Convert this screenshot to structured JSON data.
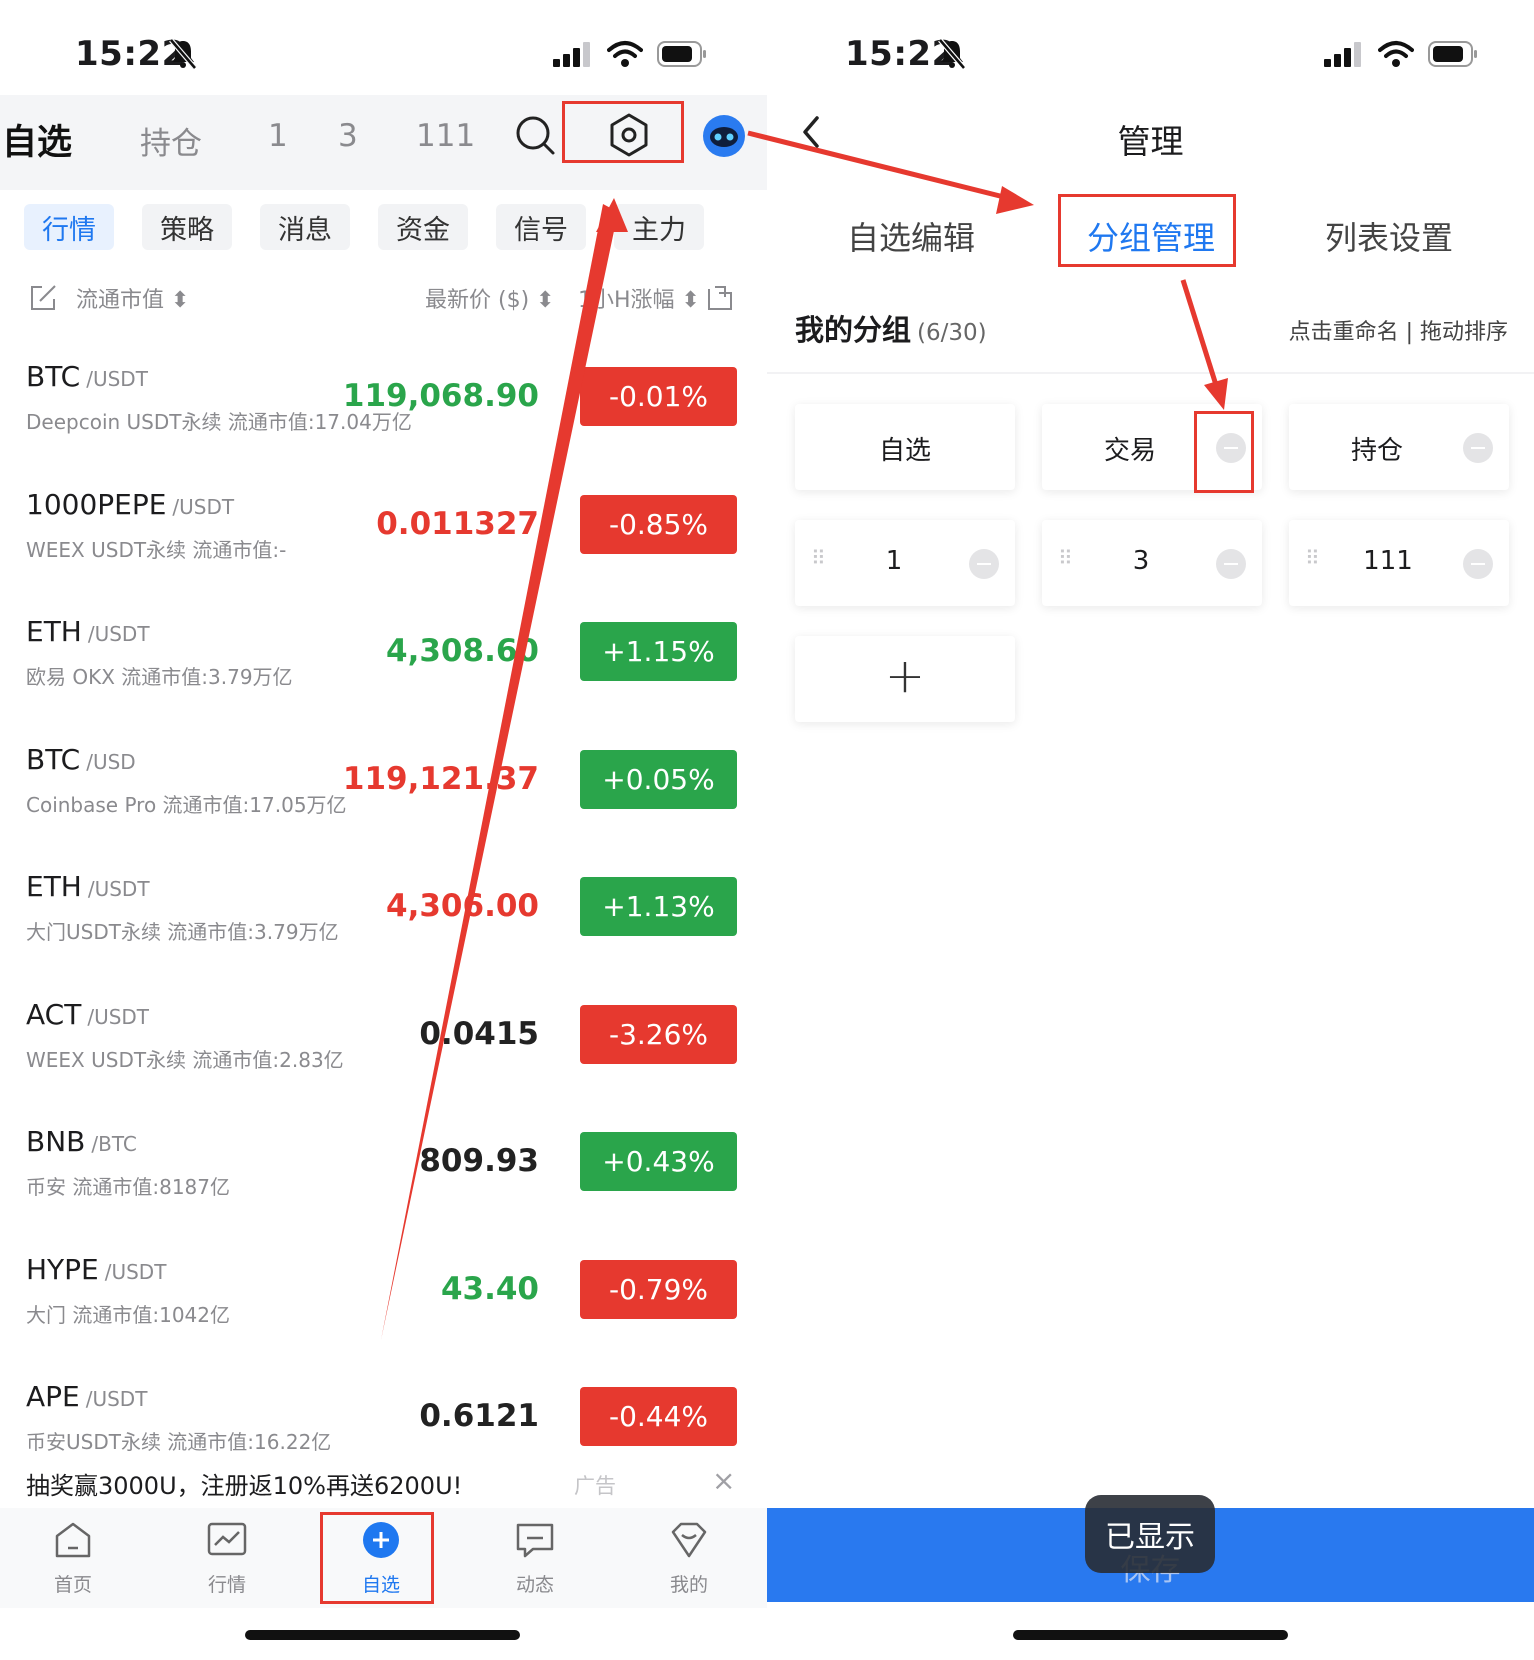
{
  "status": {
    "time": "15:22"
  },
  "left": {
    "group_tabs": [
      "自选",
      "持仓",
      "1",
      "3",
      "111"
    ],
    "sub_tabs": [
      "行情",
      "策略",
      "消息",
      "资金",
      "信号",
      "主力"
    ],
    "columns": {
      "market_cap": "流通市值",
      "latest_price": "最新价 ($)",
      "change_24h": "1小H涨幅"
    },
    "rows": [
      {
        "base": "BTC",
        "quote": "/USDT",
        "sub": "Deepcoin USDT永续  流通市值:17.04万亿",
        "price": "119,068.90",
        "change": "-0.01%",
        "price_dir": "up",
        "chg_dir": "down"
      },
      {
        "base": "1000PEPE",
        "quote": "/USDT",
        "sub": "WEEX USDT永续  流通市值:-",
        "price": "0.011327",
        "change": "-0.85%",
        "price_dir": "down",
        "chg_dir": "down"
      },
      {
        "base": "ETH",
        "quote": "/USDT",
        "sub": "欧易 OKX  流通市值:3.79万亿",
        "price": "4,308.60",
        "change": "+1.15%",
        "price_dir": "up",
        "chg_dir": "up"
      },
      {
        "base": "BTC",
        "quote": "/USD",
        "sub": "Coinbase Pro  流通市值:17.05万亿",
        "price": "119,121.37",
        "change": "+0.05%",
        "price_dir": "down",
        "chg_dir": "up"
      },
      {
        "base": "ETH",
        "quote": "/USDT",
        "sub": "大门USDT永续  流通市值:3.79万亿",
        "price": "4,306.00",
        "change": "+1.13%",
        "price_dir": "down",
        "chg_dir": "up"
      },
      {
        "base": "ACT",
        "quote": "/USDT",
        "sub": "WEEX USDT永续  流通市值:2.83亿",
        "price": "0.0415",
        "change": "-3.26%",
        "price_dir": "flat",
        "chg_dir": "down"
      },
      {
        "base": "BNB",
        "quote": "/BTC",
        "sub": "币安  流通市值:8187亿",
        "price": "809.93",
        "change": "+0.43%",
        "price_dir": "flat",
        "chg_dir": "up"
      },
      {
        "base": "HYPE",
        "quote": "/USDT",
        "sub": "大门  流通市值:1042亿",
        "price": "43.40",
        "change": "-0.79%",
        "price_dir": "up",
        "chg_dir": "down"
      },
      {
        "base": "APE",
        "quote": "/USDT",
        "sub": "币安USDT永续  流通市值:16.22亿",
        "price": "0.6121",
        "change": "-0.44%",
        "price_dir": "flat",
        "chg_dir": "down"
      }
    ],
    "ad": {
      "text": "抽奖赢3000U，注册返10%再送6200U!",
      "tag": "广告",
      "close": "×"
    },
    "tabbar": [
      "首页",
      "行情",
      "自选",
      "动态",
      "我的"
    ]
  },
  "right": {
    "title": "管理",
    "tabs": [
      "自选编辑",
      "分组管理",
      "列表设置"
    ],
    "section": {
      "title": "我的分组",
      "count": "(6/30)",
      "hint": "点击重命名 | 拖动排序"
    },
    "groups": [
      "自选",
      "交易",
      "持仓",
      "1",
      "3",
      "111"
    ],
    "add": "+",
    "save": "保存",
    "toast": "已显示"
  },
  "colors": {
    "accent": "#1f78f0",
    "up": "#2aa54b",
    "down": "#e6392f",
    "annotation": "#e6392f",
    "save_bar": "#2979ef"
  }
}
